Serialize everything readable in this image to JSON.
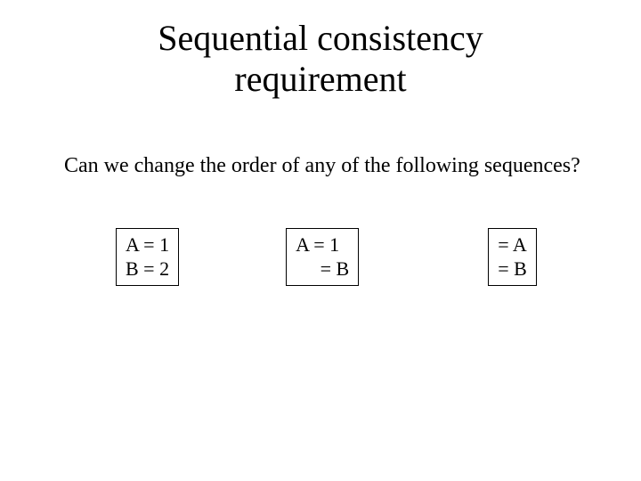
{
  "title_line1": "Sequential consistency",
  "title_line2": "requirement",
  "question": "Can we change the order of any of the following sequences?",
  "boxes": {
    "b1": {
      "line1": "A = 1",
      "line2": "B = 2"
    },
    "b2": {
      "line1": "A = 1",
      "line2": "     = B"
    },
    "b3": {
      "line1": "= A",
      "line2": "= B"
    }
  }
}
